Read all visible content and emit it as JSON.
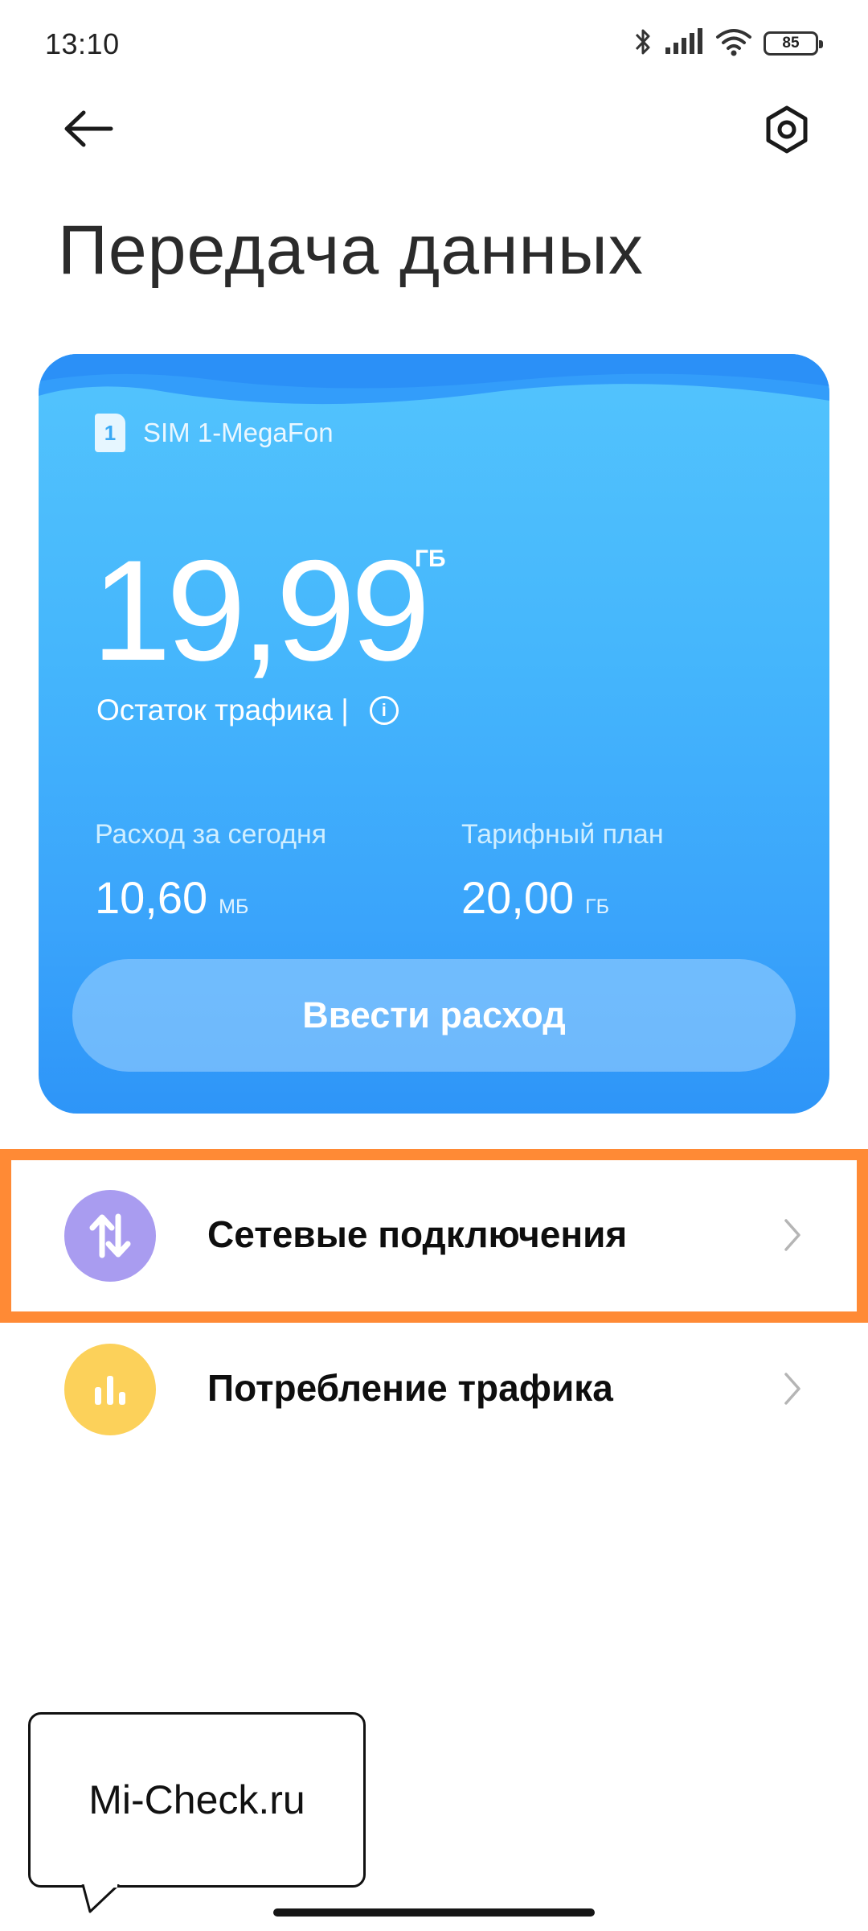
{
  "status_bar": {
    "time": "13:10",
    "battery": "85",
    "icons": [
      "bluetooth-icon",
      "signal-icon",
      "wifi-icon",
      "battery-icon"
    ]
  },
  "header": {
    "back_icon": "arrow-left-icon",
    "settings_icon": "gear-icon",
    "title": "Передача данных"
  },
  "card": {
    "sim_number": "1",
    "sim_name": "SIM 1-MegaFon",
    "remaining_value": "19,99",
    "remaining_unit": "ГБ",
    "remaining_label": "Остаток трафика |",
    "today_label": "Расход за сегодня",
    "today_value": "10,60",
    "today_unit": "МБ",
    "plan_label": "Тарифный план",
    "plan_value": "20,00",
    "plan_unit": "ГБ",
    "enter_button": "Ввести расход",
    "colors": {
      "top": "#53c4fd",
      "bottom": "#2e95f8"
    }
  },
  "list": [
    {
      "label": "Сетевые подключения",
      "icon": "arrows-up-down-icon",
      "icon_color": "#a99cf0",
      "highlighted": true
    },
    {
      "label": "Потребление трафика",
      "icon": "bar-chart-icon",
      "icon_color": "#fcd15a",
      "highlighted": false
    }
  ],
  "highlight_color": "#ff8a35",
  "watermark": {
    "text": "Mi-Check.ru"
  }
}
